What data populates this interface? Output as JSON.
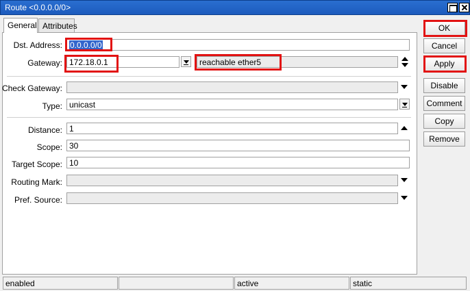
{
  "window": {
    "title": "Route <0.0.0.0/0>"
  },
  "tabs": [
    {
      "label": "General"
    },
    {
      "label": "Attributes"
    }
  ],
  "form": {
    "dst_address": {
      "label": "Dst. Address:",
      "value": "0.0.0.0/0"
    },
    "gateway": {
      "label": "Gateway:",
      "value": "172.18.0.1",
      "status": "reachable ether5"
    },
    "check_gateway": {
      "label": "Check Gateway:",
      "value": ""
    },
    "type": {
      "label": "Type:",
      "value": "unicast"
    },
    "distance": {
      "label": "Distance:",
      "value": "1"
    },
    "scope": {
      "label": "Scope:",
      "value": "30"
    },
    "target_scope": {
      "label": "Target Scope:",
      "value": "10"
    },
    "routing_mark": {
      "label": "Routing Mark:",
      "value": ""
    },
    "pref_source": {
      "label": "Pref. Source:",
      "value": ""
    }
  },
  "buttons": {
    "ok": "OK",
    "cancel": "Cancel",
    "apply": "Apply",
    "disable": "Disable",
    "comment": "Comment",
    "copy": "Copy",
    "remove": "Remove"
  },
  "statusbar": {
    "cell1": "enabled",
    "cell2": "",
    "cell3": "active",
    "cell4": "static"
  },
  "colors": {
    "titlebar": "#1c5bbd",
    "highlight": "#e21212",
    "selection": "#3366cc"
  }
}
